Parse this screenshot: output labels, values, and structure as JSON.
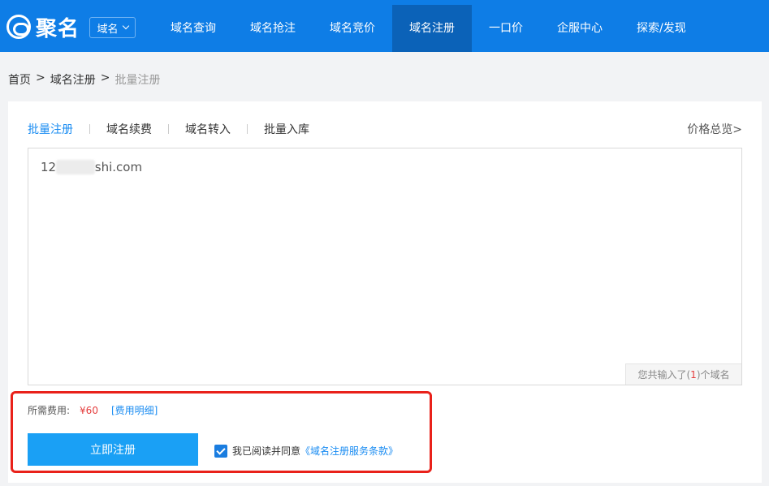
{
  "header": {
    "logo_text": "聚名",
    "domain_select": "域名",
    "nav": [
      {
        "label": "域名查询"
      },
      {
        "label": "域名抢注"
      },
      {
        "label": "域名竞价"
      },
      {
        "label": "域名注册"
      },
      {
        "label": "一口价"
      },
      {
        "label": "企服中心"
      },
      {
        "label": "探索/发现"
      }
    ],
    "active_nav": "域名注册"
  },
  "breadcrumb": {
    "items": [
      "首页",
      "域名注册",
      "批量注册"
    ],
    "separator": ">"
  },
  "tabs": [
    {
      "label": "批量注册"
    },
    {
      "label": "域名续费"
    },
    {
      "label": "域名转入"
    },
    {
      "label": "批量入库"
    }
  ],
  "active_tab": "批量注册",
  "price_overview": "价格总览>",
  "domain_input": {
    "value": "12          shi.com"
  },
  "counter": {
    "prefix": "您共输入了(",
    "count": "1",
    "suffix": ")个域名"
  },
  "fee": {
    "label": "所需费用:",
    "value": "¥60",
    "detail": "[费用明细]"
  },
  "register_button": "立即注册",
  "agreement": {
    "checked": true,
    "text": "我已阅读并同意",
    "link": "《域名注册服务条款》"
  },
  "colors": {
    "nav_bg": "#0e7de6",
    "nav_active": "#0b62b8",
    "accent": "#1a8cf2",
    "button": "#1aa0f5",
    "price": "#e43c3c",
    "highlight_border": "#e9211a"
  }
}
